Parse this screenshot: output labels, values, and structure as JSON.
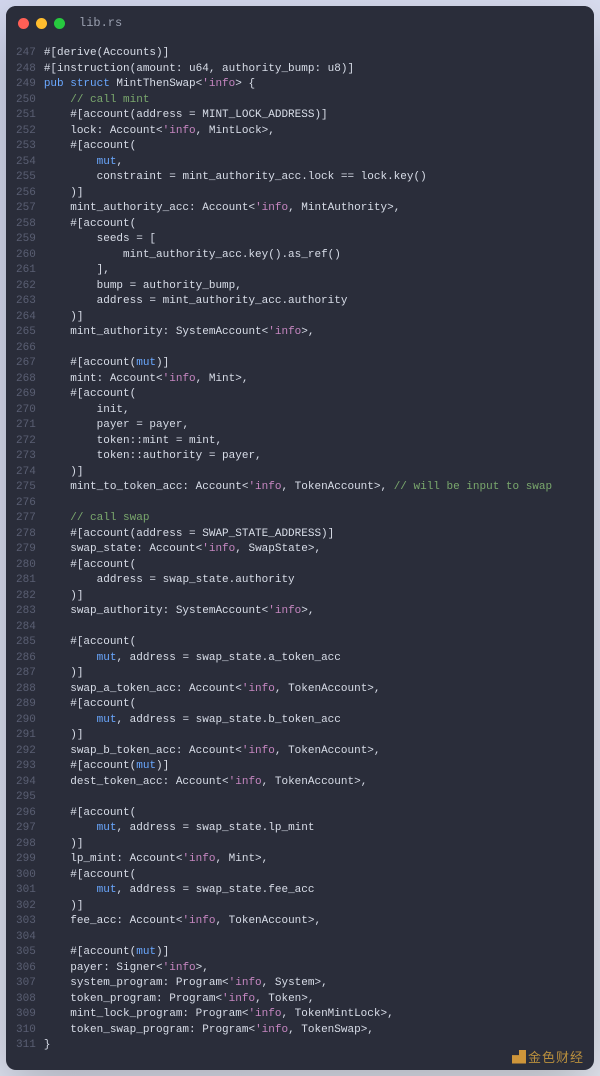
{
  "filename": "lib.rs",
  "line_start": 247,
  "line_end": 311,
  "watermark": "金色财经",
  "code_lines": [
    {
      "indent": 0,
      "tokens": [
        {
          "t": "attr",
          "v": "#[derive(Accounts)]"
        }
      ]
    },
    {
      "indent": 0,
      "tokens": [
        {
          "t": "attr",
          "v": "#[instruction(amount: u64, authority_bump: u8)]"
        }
      ]
    },
    {
      "indent": 0,
      "tokens": [
        {
          "t": "keyword",
          "v": "pub struct"
        },
        {
          "t": "plain",
          "v": " MintThenSwap<"
        },
        {
          "t": "lifetime",
          "v": "'info"
        },
        {
          "t": "plain",
          "v": "> {"
        }
      ]
    },
    {
      "indent": 1,
      "tokens": [
        {
          "t": "comment",
          "v": "// call mint"
        }
      ]
    },
    {
      "indent": 1,
      "tokens": [
        {
          "t": "attr",
          "v": "#[account(address = MINT_LOCK_ADDRESS)]"
        }
      ]
    },
    {
      "indent": 1,
      "tokens": [
        {
          "t": "plain",
          "v": "lock: Account<"
        },
        {
          "t": "lifetime",
          "v": "'info"
        },
        {
          "t": "plain",
          "v": ", MintLock>,"
        }
      ]
    },
    {
      "indent": 1,
      "tokens": [
        {
          "t": "attr",
          "v": "#[account("
        }
      ]
    },
    {
      "indent": 2,
      "tokens": [
        {
          "t": "mut",
          "v": "mut"
        },
        {
          "t": "plain",
          "v": ","
        }
      ]
    },
    {
      "indent": 2,
      "tokens": [
        {
          "t": "plain",
          "v": "constraint = mint_authority_acc.lock == lock.key()"
        }
      ]
    },
    {
      "indent": 1,
      "tokens": [
        {
          "t": "attr",
          "v": ")]"
        }
      ]
    },
    {
      "indent": 1,
      "tokens": [
        {
          "t": "plain",
          "v": "mint_authority_acc: Account<"
        },
        {
          "t": "lifetime",
          "v": "'info"
        },
        {
          "t": "plain",
          "v": ", MintAuthority>,"
        }
      ]
    },
    {
      "indent": 1,
      "tokens": [
        {
          "t": "attr",
          "v": "#[account("
        }
      ]
    },
    {
      "indent": 2,
      "tokens": [
        {
          "t": "plain",
          "v": "seeds = ["
        }
      ]
    },
    {
      "indent": 3,
      "tokens": [
        {
          "t": "plain",
          "v": "mint_authority_acc.key().as_ref()"
        }
      ]
    },
    {
      "indent": 2,
      "tokens": [
        {
          "t": "plain",
          "v": "],"
        }
      ]
    },
    {
      "indent": 2,
      "tokens": [
        {
          "t": "plain",
          "v": "bump = authority_bump,"
        }
      ]
    },
    {
      "indent": 2,
      "tokens": [
        {
          "t": "plain",
          "v": "address = mint_authority_acc.authority"
        }
      ]
    },
    {
      "indent": 1,
      "tokens": [
        {
          "t": "attr",
          "v": ")]"
        }
      ]
    },
    {
      "indent": 1,
      "tokens": [
        {
          "t": "plain",
          "v": "mint_authority: SystemAccount<"
        },
        {
          "t": "lifetime",
          "v": "'info"
        },
        {
          "t": "plain",
          "v": ">,"
        }
      ]
    },
    {
      "indent": 0,
      "tokens": []
    },
    {
      "indent": 1,
      "tokens": [
        {
          "t": "attr",
          "v": "#[account("
        },
        {
          "t": "mut",
          "v": "mut"
        },
        {
          "t": "attr",
          "v": ")]"
        }
      ]
    },
    {
      "indent": 1,
      "tokens": [
        {
          "t": "plain",
          "v": "mint: Account<"
        },
        {
          "t": "lifetime",
          "v": "'info"
        },
        {
          "t": "plain",
          "v": ", Mint>,"
        }
      ]
    },
    {
      "indent": 1,
      "tokens": [
        {
          "t": "attr",
          "v": "#[account("
        }
      ]
    },
    {
      "indent": 2,
      "tokens": [
        {
          "t": "plain",
          "v": "init,"
        }
      ]
    },
    {
      "indent": 2,
      "tokens": [
        {
          "t": "plain",
          "v": "payer = payer,"
        }
      ]
    },
    {
      "indent": 2,
      "tokens": [
        {
          "t": "plain",
          "v": "token::mint = mint,"
        }
      ]
    },
    {
      "indent": 2,
      "tokens": [
        {
          "t": "plain",
          "v": "token::authority = payer,"
        }
      ]
    },
    {
      "indent": 1,
      "tokens": [
        {
          "t": "attr",
          "v": ")]"
        }
      ]
    },
    {
      "indent": 1,
      "tokens": [
        {
          "t": "plain",
          "v": "mint_to_token_acc: Account<"
        },
        {
          "t": "lifetime",
          "v": "'info"
        },
        {
          "t": "plain",
          "v": ", TokenAccount>, "
        },
        {
          "t": "comment",
          "v": "// will be input to swap"
        }
      ]
    },
    {
      "indent": 0,
      "tokens": []
    },
    {
      "indent": 1,
      "tokens": [
        {
          "t": "comment",
          "v": "// call swap"
        }
      ]
    },
    {
      "indent": 1,
      "tokens": [
        {
          "t": "attr",
          "v": "#[account(address = SWAP_STATE_ADDRESS)]"
        }
      ]
    },
    {
      "indent": 1,
      "tokens": [
        {
          "t": "plain",
          "v": "swap_state: Account<"
        },
        {
          "t": "lifetime",
          "v": "'info"
        },
        {
          "t": "plain",
          "v": ", SwapState>,"
        }
      ]
    },
    {
      "indent": 1,
      "tokens": [
        {
          "t": "attr",
          "v": "#[account("
        }
      ]
    },
    {
      "indent": 2,
      "tokens": [
        {
          "t": "plain",
          "v": "address = swap_state.authority"
        }
      ]
    },
    {
      "indent": 1,
      "tokens": [
        {
          "t": "attr",
          "v": ")]"
        }
      ]
    },
    {
      "indent": 1,
      "tokens": [
        {
          "t": "plain",
          "v": "swap_authority: SystemAccount<"
        },
        {
          "t": "lifetime",
          "v": "'info"
        },
        {
          "t": "plain",
          "v": ">,"
        }
      ]
    },
    {
      "indent": 0,
      "tokens": []
    },
    {
      "indent": 1,
      "tokens": [
        {
          "t": "attr",
          "v": "#[account("
        }
      ]
    },
    {
      "indent": 2,
      "tokens": [
        {
          "t": "mut",
          "v": "mut"
        },
        {
          "t": "plain",
          "v": ", address = swap_state.a_token_acc"
        }
      ]
    },
    {
      "indent": 1,
      "tokens": [
        {
          "t": "attr",
          "v": ")]"
        }
      ]
    },
    {
      "indent": 1,
      "tokens": [
        {
          "t": "plain",
          "v": "swap_a_token_acc: Account<"
        },
        {
          "t": "lifetime",
          "v": "'info"
        },
        {
          "t": "plain",
          "v": ", TokenAccount>,"
        }
      ]
    },
    {
      "indent": 1,
      "tokens": [
        {
          "t": "attr",
          "v": "#[account("
        }
      ]
    },
    {
      "indent": 2,
      "tokens": [
        {
          "t": "mut",
          "v": "mut"
        },
        {
          "t": "plain",
          "v": ", address = swap_state.b_token_acc"
        }
      ]
    },
    {
      "indent": 1,
      "tokens": [
        {
          "t": "attr",
          "v": ")]"
        }
      ]
    },
    {
      "indent": 1,
      "tokens": [
        {
          "t": "plain",
          "v": "swap_b_token_acc: Account<"
        },
        {
          "t": "lifetime",
          "v": "'info"
        },
        {
          "t": "plain",
          "v": ", TokenAccount>,"
        }
      ]
    },
    {
      "indent": 1,
      "tokens": [
        {
          "t": "attr",
          "v": "#[account("
        },
        {
          "t": "mut",
          "v": "mut"
        },
        {
          "t": "attr",
          "v": ")]"
        }
      ]
    },
    {
      "indent": 1,
      "tokens": [
        {
          "t": "plain",
          "v": "dest_token_acc: Account<"
        },
        {
          "t": "lifetime",
          "v": "'info"
        },
        {
          "t": "plain",
          "v": ", TokenAccount>,"
        }
      ]
    },
    {
      "indent": 0,
      "tokens": []
    },
    {
      "indent": 1,
      "tokens": [
        {
          "t": "attr",
          "v": "#[account("
        }
      ]
    },
    {
      "indent": 2,
      "tokens": [
        {
          "t": "mut",
          "v": "mut"
        },
        {
          "t": "plain",
          "v": ", address = swap_state.lp_mint"
        }
      ]
    },
    {
      "indent": 1,
      "tokens": [
        {
          "t": "attr",
          "v": ")]"
        }
      ]
    },
    {
      "indent": 1,
      "tokens": [
        {
          "t": "plain",
          "v": "lp_mint: Account<"
        },
        {
          "t": "lifetime",
          "v": "'info"
        },
        {
          "t": "plain",
          "v": ", Mint>,"
        }
      ]
    },
    {
      "indent": 1,
      "tokens": [
        {
          "t": "attr",
          "v": "#[account("
        }
      ]
    },
    {
      "indent": 2,
      "tokens": [
        {
          "t": "mut",
          "v": "mut"
        },
        {
          "t": "plain",
          "v": ", address = swap_state.fee_acc"
        }
      ]
    },
    {
      "indent": 1,
      "tokens": [
        {
          "t": "attr",
          "v": ")]"
        }
      ]
    },
    {
      "indent": 1,
      "tokens": [
        {
          "t": "plain",
          "v": "fee_acc: Account<"
        },
        {
          "t": "lifetime",
          "v": "'info"
        },
        {
          "t": "plain",
          "v": ", TokenAccount>,"
        }
      ]
    },
    {
      "indent": 0,
      "tokens": []
    },
    {
      "indent": 1,
      "tokens": [
        {
          "t": "attr",
          "v": "#[account("
        },
        {
          "t": "mut",
          "v": "mut"
        },
        {
          "t": "attr",
          "v": ")]"
        }
      ]
    },
    {
      "indent": 1,
      "tokens": [
        {
          "t": "plain",
          "v": "payer: Signer<"
        },
        {
          "t": "lifetime",
          "v": "'info"
        },
        {
          "t": "plain",
          "v": ">,"
        }
      ]
    },
    {
      "indent": 1,
      "tokens": [
        {
          "t": "plain",
          "v": "system_program: Program<"
        },
        {
          "t": "lifetime",
          "v": "'info"
        },
        {
          "t": "plain",
          "v": ", System>,"
        }
      ]
    },
    {
      "indent": 1,
      "tokens": [
        {
          "t": "plain",
          "v": "token_program: Program<"
        },
        {
          "t": "lifetime",
          "v": "'info"
        },
        {
          "t": "plain",
          "v": ", Token>,"
        }
      ]
    },
    {
      "indent": 1,
      "tokens": [
        {
          "t": "plain",
          "v": "mint_lock_program: Program<"
        },
        {
          "t": "lifetime",
          "v": "'info"
        },
        {
          "t": "plain",
          "v": ", TokenMintLock>,"
        }
      ]
    },
    {
      "indent": 1,
      "tokens": [
        {
          "t": "plain",
          "v": "token_swap_program: Program<"
        },
        {
          "t": "lifetime",
          "v": "'info"
        },
        {
          "t": "plain",
          "v": ", TokenSwap>,"
        }
      ]
    },
    {
      "indent": 0,
      "tokens": [
        {
          "t": "plain",
          "v": "}"
        }
      ]
    }
  ]
}
